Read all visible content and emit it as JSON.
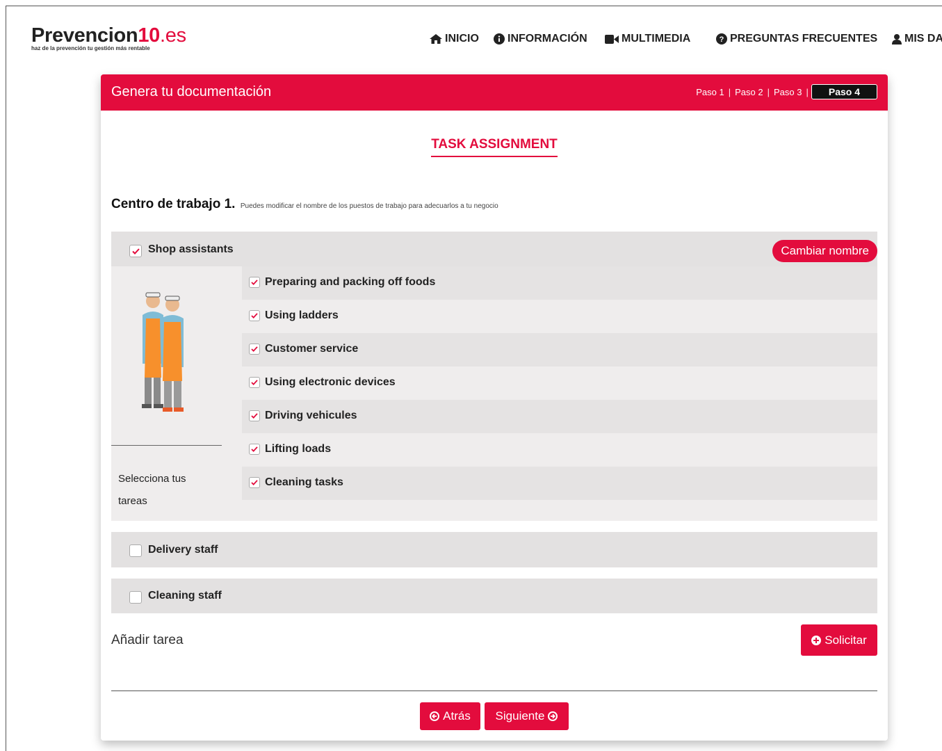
{
  "header": {
    "logo_main": "Prevencion",
    "logo_num": "10",
    "logo_domain": ".es",
    "logo_tagline": "haz de la prevención tu gestión más rentable",
    "nav": [
      {
        "label": "INICIO",
        "icon": "home-icon"
      },
      {
        "label": "INFORMACIÓN",
        "icon": "info-icon"
      },
      {
        "label": "MULTIMEDIA",
        "icon": "video-camera-icon"
      },
      {
        "label": "PREGUNTAS FRECUENTES",
        "icon": "question-icon"
      },
      {
        "label": "MIS DA",
        "icon": "user-icon"
      }
    ]
  },
  "card": {
    "title": "Genera tu documentación",
    "steps": [
      "Paso 1",
      "Paso 2",
      "Paso 3"
    ],
    "active_step": "Paso 4",
    "section_title": "TASK ASSIGNMENT",
    "centro_label": "Centro de trabajo 1.",
    "centro_hint": "Puedes modificar el nombre de los puestos de trabajo para adecuarlos a tu negocio"
  },
  "groups": [
    {
      "name": "Shop assistants",
      "checked": true,
      "rename_label": "Cambiar nombre"
    },
    {
      "name": "Delivery staff",
      "checked": false
    },
    {
      "name": "Cleaning staff",
      "checked": false
    }
  ],
  "tasks": [
    {
      "label": "Preparing and packing off foods",
      "checked": true
    },
    {
      "label": "Using ladders",
      "checked": true
    },
    {
      "label": "Customer service",
      "checked": true
    },
    {
      "label": "Using electronic devices",
      "checked": true
    },
    {
      "label": "Driving vehicules",
      "checked": true
    },
    {
      "label": "Lifting loads",
      "checked": true
    },
    {
      "label": "Cleaning tasks",
      "checked": true
    }
  ],
  "select_tasks_text": "Selecciona tus tareas",
  "add_task_label": "Añadir tarea",
  "request_button": "Solicitar",
  "back_button": "Atrás",
  "next_button": "Siguiente",
  "colors": {
    "accent": "#e30c3d",
    "row_dark": "#e5e3e3",
    "row_light": "#efeded"
  }
}
